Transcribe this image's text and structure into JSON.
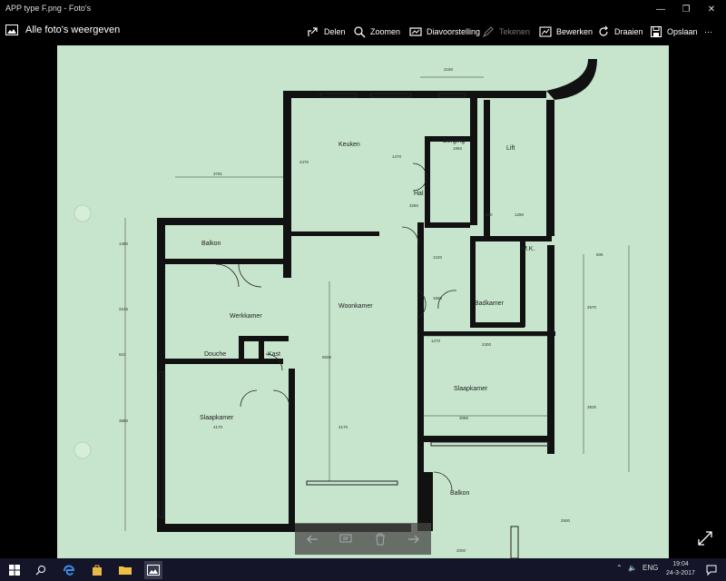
{
  "window": {
    "title": "APP type F.png - Foto's"
  },
  "toolbar": {
    "back_label": "Alle foto's weergeven",
    "share": "Delen",
    "zoom": "Zoomen",
    "slideshow": "Diavoorstelling",
    "draw": "Tekenen",
    "edit": "Bewerken",
    "rotate": "Draaien",
    "save": "Opslaan"
  },
  "plan": {
    "rooms": {
      "keuken": "Keuken",
      "berging": "Berging",
      "lift": "Lift",
      "hal": "Hal",
      "balkon_left": "Balkon",
      "werkkamer": "Werkkamer",
      "woonkamer": "Woonkamer",
      "douche": "Douche",
      "kast": "Kast",
      "mk": "M.K.",
      "badkamer": "Badkamer",
      "slaapkamer_left": "Slaapkamer",
      "slaapkamer_right": "Slaapkamer",
      "balkon_right": "Balkon"
    },
    "dimensions": {
      "d2160": "2160",
      "d1860": "1860",
      "d1470": "1470",
      "d4470": "4470",
      "d3781": "3781",
      "d3280": "3280",
      "d930": "930",
      "d1290": "1290",
      "d1480": "1480",
      "d2245": "2245",
      "d910": "910",
      "d3980": "3980",
      "d6505": "6505",
      "d4170a": "4170",
      "d4170b": "4170",
      "d1270": "1270",
      "d2300": "2300",
      "d2570": "2570",
      "d3085": "3085",
      "d3925": "3925",
      "d1660": "1660",
      "d1220": "1220",
      "d2000": "2000",
      "d2500": "2500",
      "d605": "605"
    }
  },
  "taskbar": {
    "language": "ENG",
    "time": "19:04",
    "date": "24-3-2017"
  }
}
